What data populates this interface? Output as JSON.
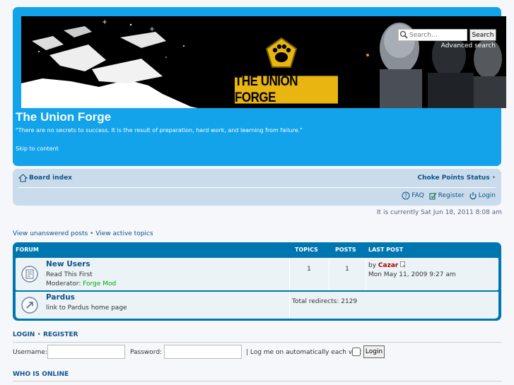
{
  "header": {
    "logo_text": "THE UNION FORGE",
    "search_placeholder": "Search…",
    "search_button": "Search",
    "advanced_search": "Advanced search",
    "site_title": "The Union Forge",
    "site_description": "\"There are no secrets to success. It is the result of preparation, hard work, and learning from failure.\"",
    "skip_link": "Skip to content"
  },
  "navbar": {
    "board_index": "Board index",
    "choke_points": "Choke Points Status",
    "choke_sep": "•",
    "faq": "FAQ",
    "register": "Register",
    "login": "Login"
  },
  "time_text": "It is currently Sat Jun 18, 2011 8:08 am",
  "quick_links": {
    "unanswered": "View unanswered posts",
    "sep": "•",
    "active": "View active topics"
  },
  "forum_table": {
    "columns": {
      "forum": "FORUM",
      "topics": "TOPICS",
      "posts": "POSTS",
      "last_post": "LAST POST"
    },
    "rows": [
      {
        "name": "New Users",
        "description": "Read This First",
        "moderator_label": "Moderator:",
        "moderator": "Forge Mod",
        "topics": "1",
        "posts": "1",
        "last_post_by": "by",
        "last_post_author": "Cazar",
        "last_post_date": "Mon May 11, 2009 9:27 am"
      },
      {
        "name": "Pardus",
        "description": "link to Pardus home page",
        "redirects": "Total redirects: 2129"
      }
    ]
  },
  "login_section": {
    "heading_login": "LOGIN",
    "heading_sep": "•",
    "heading_register": "REGISTER",
    "username_label": "Username:",
    "password_label": "Password:",
    "autologin_label": "| Log me on automatically each visit",
    "login_button": "Login"
  },
  "who_is_online": "WHO IS ONLINE",
  "colors": {
    "header_blue": "#12a3eb",
    "forum_header": "#0076b1",
    "navbar_bg": "#cadceb",
    "logo_yellow": "#e8b511",
    "moderator_green": "#00aa00",
    "author_red": "#aa0000"
  }
}
